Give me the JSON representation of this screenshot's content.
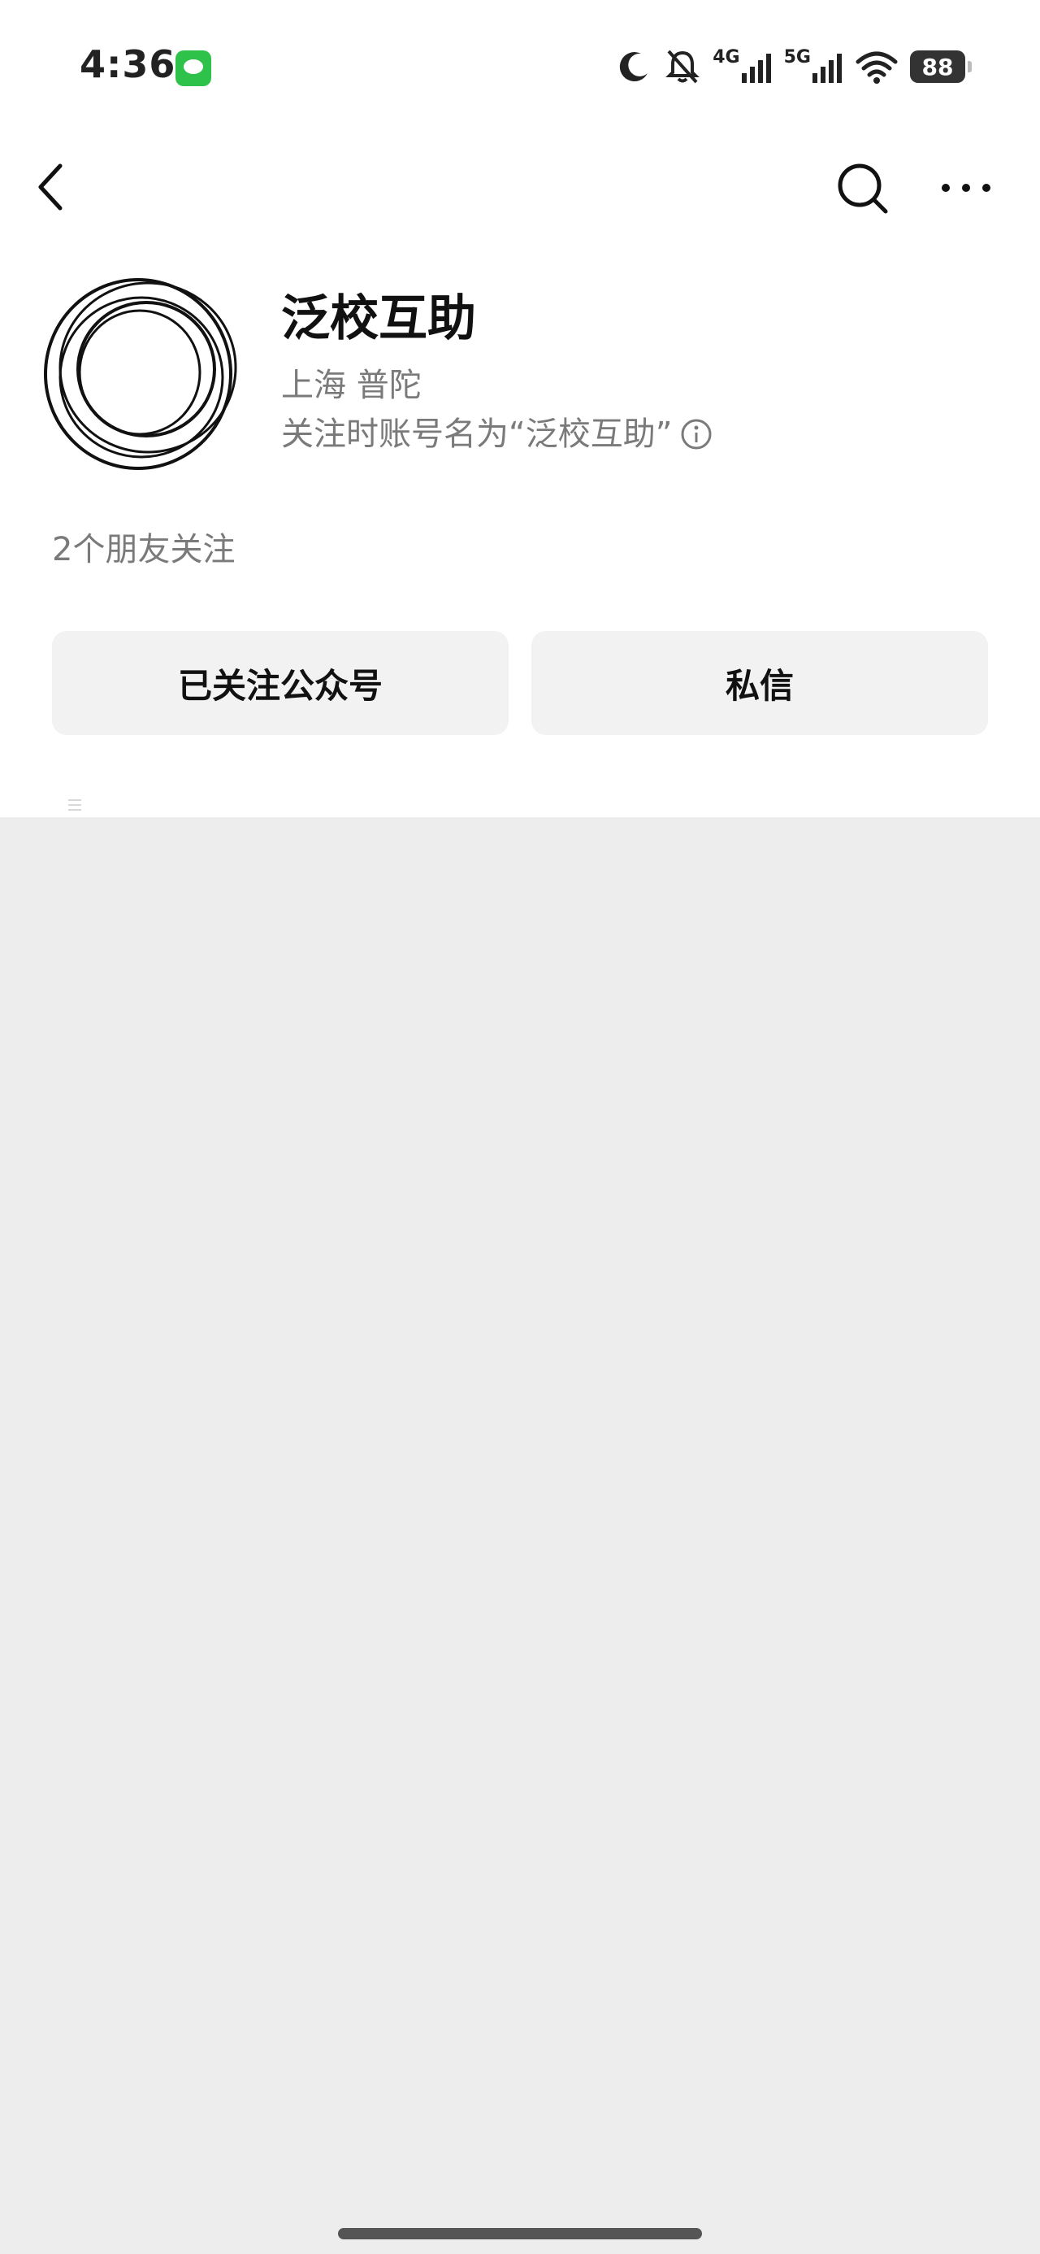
{
  "status_bar": {
    "time": "4:36",
    "network_1": "4G",
    "network_2": "5G",
    "battery": "88",
    "icons": [
      "message-icon",
      "moon-icon",
      "mute-bell-icon",
      "signal-icon",
      "wifi-icon"
    ]
  },
  "nav": {
    "back_icon": "chevron-left-icon",
    "search_icon": "search-icon",
    "more_icon": "more-dots-icon"
  },
  "profile": {
    "name": "泛校互助",
    "location": "上海 普陀",
    "follow_note": "关注时账号名为“泛校互助”",
    "friends": "2个朋友关注"
  },
  "actions": {
    "follow_label": "已关注公众号",
    "message_label": "私信"
  },
  "colors": {
    "background": "#ededed",
    "panel": "#ffffff",
    "button": "#f2f2f2",
    "secondary_text": "#7a7a7a"
  }
}
